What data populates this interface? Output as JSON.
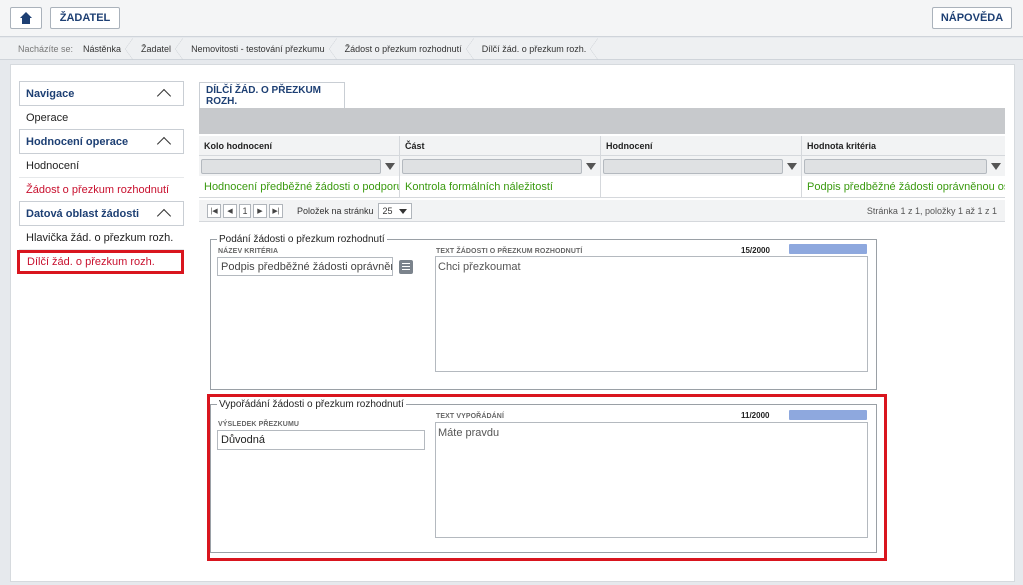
{
  "topbar": {
    "zadatel_label": "ŽADATEL",
    "help_label": "NÁPOVĚDA",
    "home_icon": "home-icon"
  },
  "breadcrumb": {
    "label": "Nacházíte se:",
    "items": [
      "Nástěnka",
      "Žadatel",
      "Nemovitosti - testování přezkumu",
      "Žádost o přezkum rozhodnutí",
      "Dílčí žád. o přezkum rozh."
    ]
  },
  "sidebar": {
    "sections": [
      {
        "title": "Navigace",
        "items": [
          "Operace"
        ]
      },
      {
        "title": "Hodnocení operace",
        "items": [
          "Hodnocení",
          "Žádost o přezkum rozhodnutí"
        ]
      },
      {
        "title": "Datová oblast žádosti",
        "items": [
          "Hlavička žád. o přezkum rozh.",
          "Dílčí žád. o přezkum rozh."
        ]
      }
    ]
  },
  "tab": {
    "label": "DÍLČÍ ŽÁD. O PŘEZKUM ROZH."
  },
  "grid": {
    "columns": [
      "Kolo hodnocení",
      "Část",
      "Hodnocení",
      "Hodnota kritéria"
    ],
    "rows": [
      [
        "Hodnocení předběžné žádosti o podporu",
        "Kontrola formálních náležitostí",
        "",
        "Podpis předběžné žádosti oprávněnou osobou"
      ]
    ],
    "pager": {
      "current_page": "1",
      "per_page_label": "Položek na stránku",
      "per_page_value": "25",
      "info": "Stránka 1 z 1, položky 1 až 1 z 1"
    }
  },
  "podani": {
    "legend": "Podání žádosti o přezkum rozhodnutí",
    "nazev_label": "NÁZEV KRITÉRIA",
    "nazev_value": "Podpis předběžné žádosti oprávněnou...",
    "text_label": "TEXT ŽÁDOSTI O PŘEZKUM ROZHODNUTÍ",
    "count": "15/2000",
    "text_value": "Chci přezkoumat"
  },
  "vyporadani": {
    "legend": "Vypořádání žádosti o přezkum rozhodnutí",
    "vysledek_label": "VÝSLEDEK PŘEZKUMU",
    "vysledek_value": "Důvodná",
    "text_label": "TEXT VYPOŘÁDÁNÍ",
    "count": "11/2000",
    "text_value": "Máte pravdu"
  },
  "colors": {
    "accent": "#1d3f73",
    "highlight": "#d9151e",
    "green": "#3a9a0f"
  }
}
